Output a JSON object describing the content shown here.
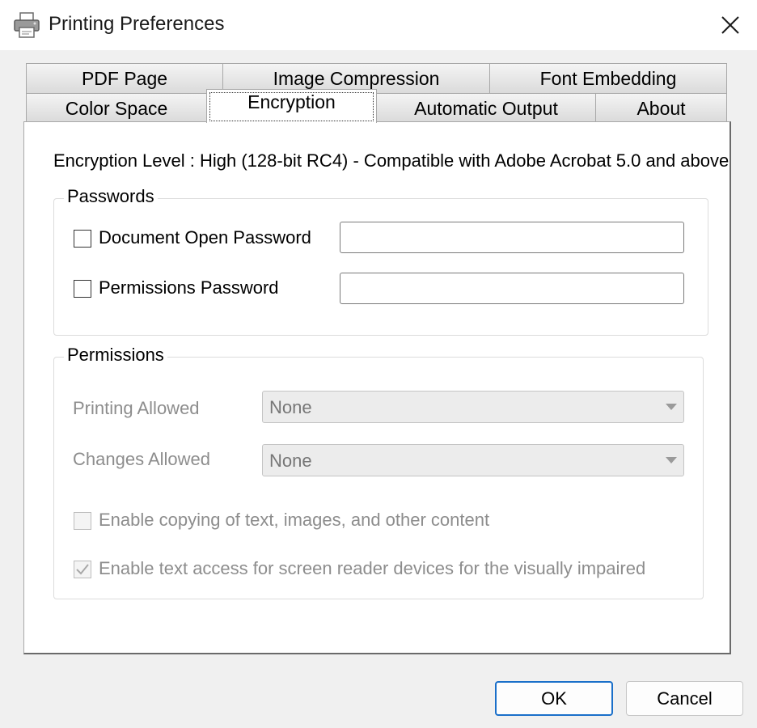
{
  "window": {
    "title": "Printing Preferences",
    "title_icon": "printer-icon",
    "close_icon": "close-icon"
  },
  "tabs": {
    "row1": [
      "PDF Page",
      "Image Compression",
      "Font Embedding"
    ],
    "row2": [
      "Color Space",
      "Encryption",
      "Automatic Output",
      "About"
    ],
    "active": "Encryption"
  },
  "encryption": {
    "level_text": "Encryption Level : High (128-bit RC4) - Compatible with Adobe Acrobat 5.0 and above",
    "passwords": {
      "group_label": "Passwords",
      "open_password": {
        "label": "Document Open Password",
        "checked": false,
        "value": ""
      },
      "permissions_password": {
        "label": "Permissions Password",
        "checked": false,
        "value": ""
      }
    },
    "permissions": {
      "group_label": "Permissions",
      "printing": {
        "label": "Printing Allowed",
        "value": "None",
        "enabled": false
      },
      "changes": {
        "label": "Changes Allowed",
        "value": "None",
        "enabled": false
      },
      "copying": {
        "label": "Enable copying of text, images, and other content",
        "checked": false,
        "enabled": false
      },
      "screen_reader": {
        "label": "Enable text access for screen reader devices for the visually impaired",
        "checked": true,
        "enabled": false
      }
    }
  },
  "buttons": {
    "ok": "OK",
    "cancel": "Cancel"
  },
  "colors": {
    "default_button_border": "#1a6fc9",
    "disabled_text": "#8d8d8d"
  }
}
